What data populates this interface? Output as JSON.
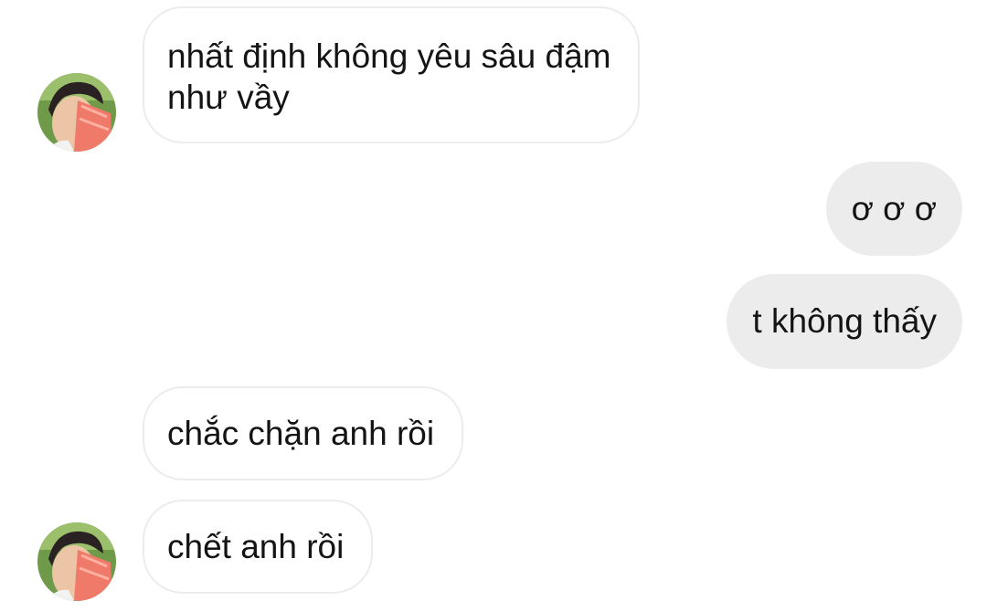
{
  "messages": [
    {
      "direction": "incoming",
      "text_lines": [
        "nhất định không yêu sâu đậm",
        "như vầy"
      ],
      "avatar": "contact-avatar"
    },
    {
      "direction": "outgoing",
      "text": "ơ ơ ơ"
    },
    {
      "direction": "outgoing",
      "text": "t không thấy"
    },
    {
      "direction": "incoming",
      "text": "chắc chặn anh rồi"
    },
    {
      "direction": "incoming",
      "text": "chết anh rồi",
      "avatar": "contact-avatar"
    }
  ],
  "colors": {
    "background": "#ffffff",
    "incoming_bubble_border": "#ececec",
    "outgoing_bubble_fill": "#ececec",
    "text": "#141414"
  }
}
